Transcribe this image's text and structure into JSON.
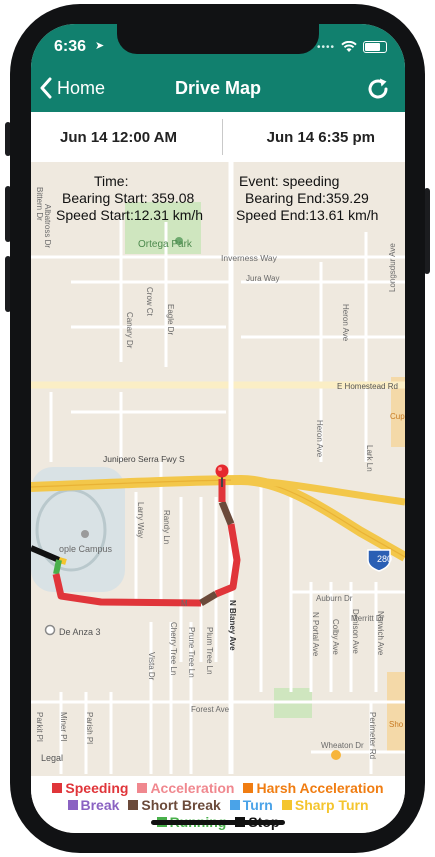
{
  "status_bar": {
    "time": "6:36",
    "location_arrow": "➤"
  },
  "nav": {
    "back_label": "Home",
    "title": "Drive Map"
  },
  "date_range": {
    "start": "Jun 14  12:00 AM",
    "end": "Jun 14 6:35 pm"
  },
  "event_info": {
    "time": "Time:",
    "event": "Event: speeding",
    "bearing_start": "Bearing Start: 359.08",
    "bearing_end": "Bearing End:359.29",
    "speed_start": "Speed Start:12.31 km/h",
    "speed_end": "Speed End:13.61 km/h"
  },
  "map_labels": {
    "ortega_park": "Ortega Park",
    "inverness_way": "Inverness Way",
    "jura_way": "Jura Way",
    "heron_ave": "Heron Ave",
    "longsdur_ave": "Longsdur Ave",
    "homestead": "E Homestead Rd",
    "canary_dr": "Canary Dr",
    "crow_ct": "Crow Ct",
    "eagle_dr": "Eagle Dr",
    "albatross_dr": "Albatross Dr",
    "bittern_dr": "Bittern Dr",
    "junipero": "Junipero Serra Fwy S",
    "heron_ave_2": "Heron Ave",
    "lark_ln": "Lark Ln",
    "apple_campus": "ople Campus",
    "de_anza": "De Anza 3",
    "larry_way": "Larry Way",
    "randy_ln": "Randy Ln",
    "auburn_dr": "Auburn Dr",
    "merritt_dr": "Merritt Dr",
    "blaney_ave": "N Blaney Ave",
    "portal_ave": "N Portal Ave",
    "colby_ave": "Colby Ave",
    "denison_ave": "Denison Ave",
    "norwich_ave": "Norwich Ave",
    "cherry_tree": "Cherry Tree Ln",
    "prune_tree": "Prune Tree Ln",
    "plum_tree": "Plum Tree Ln",
    "vista_dr": "Vista Dr",
    "forest_ave": "Forest Ave",
    "parkit_pl": "Parkit Pl",
    "miner_pl": "Miner Pl",
    "parish_pl": "Parish Pl",
    "wheaton_dr": "Wheaton Dr",
    "perimeter_rd": "Perimeter Rd",
    "interstate": "280",
    "legal": "Legal",
    "cup": "Cup",
    "sho": "Sho",
    "m_label": "M"
  },
  "legend": [
    {
      "label": "Speeding",
      "color": "#e0353a"
    },
    {
      "label": "Acceleration",
      "color": "#f0888f"
    },
    {
      "label": "Harsh Acceleration",
      "color": "#f07d12"
    },
    {
      "label": "Break",
      "color": "#8a62c2"
    },
    {
      "label": "Short Break",
      "color": "#6b4a3a"
    },
    {
      "label": "Turn",
      "color": "#4aa3e8"
    },
    {
      "label": "Sharp Turn",
      "color": "#f4c52e"
    },
    {
      "label": "Running",
      "color": "#49b04b"
    },
    {
      "label": "Stop",
      "color": "#111111"
    }
  ],
  "colors": {
    "header": "#11806e",
    "accent": "#ffffff"
  }
}
